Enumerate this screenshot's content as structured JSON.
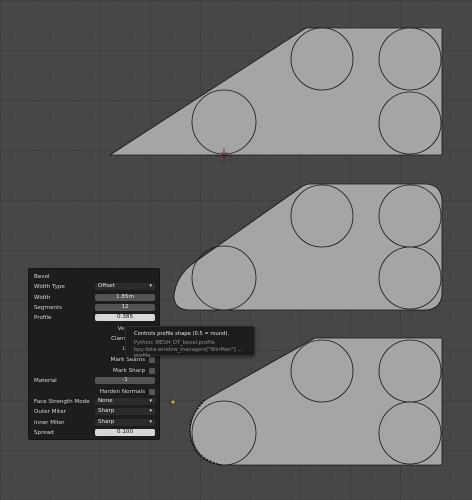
{
  "operator_panel": {
    "title": "Bevel",
    "width_type_label": "Width Type",
    "width_type_value": "Offset",
    "width_label": "Width",
    "width_value": "1.85m",
    "segments_label": "Segments",
    "segments_value": "12",
    "profile_label": "Profile",
    "profile_value": "0.385",
    "vert_label": "Vert",
    "clamp_label": "Clamp",
    "lo_label": "Lo",
    "mark_seams_label": "Mark Seams",
    "mark_sharp_label": "Mark Sharp",
    "material_label": "Material",
    "material_value": "-1",
    "harden_normals_label": "Harden Normals",
    "face_strength_label": "Face Strength Mode",
    "face_strength_value": "None",
    "outer_miter_label": "Outer Miter",
    "outer_miter_value": "Sharp",
    "inner_miter_label": "Inner Miter",
    "inner_miter_value": "Sharp",
    "spread_label": "Spread",
    "spread_value": "0.100"
  },
  "tooltip": {
    "description": "Controls profile shape (0.5 = round).",
    "python": "Python: MESH_OT_bevel.profile",
    "path": "bpy.data.window_managers[\"WinMan\"] ... profile"
  },
  "colors": {
    "viewport_bg": "#474747",
    "mesh_face": "#a5a5a5",
    "panel_bg": "#1d1d1d",
    "field_bg": "#545454",
    "field_light": "#d8d8d8"
  },
  "icons": [
    "chevron-down-icon",
    "cursor-crosshair-icon",
    "checkbox-icon"
  ]
}
